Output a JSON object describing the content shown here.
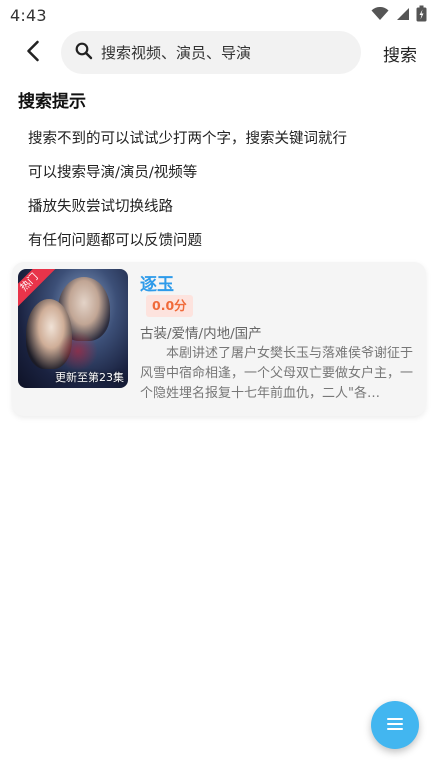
{
  "status_bar": {
    "time": "4:43"
  },
  "search": {
    "placeholder": "搜索视频、演员、导演",
    "value": "",
    "submit_label": "搜索"
  },
  "tips": {
    "title": "搜索提示",
    "items": [
      "搜索不到的可以试试少打两个字，搜索关键词就行",
      "可以搜索导演/演员/视频等",
      "播放失败尝试切换线路",
      "有任何问题都可以反馈问题"
    ]
  },
  "result": {
    "badge": "热门",
    "poster_caption": "更新至第23集",
    "title": "逐玉",
    "score": "0.0分",
    "tags": "古装/爱情/内地/国产",
    "description": "本剧讲述了屠户女樊长玉与落难侯爷谢征于风雪中宿命相逢，一个父母双亡要做女户主，一个隐姓埋名报复十七年前血仇，二人\"各…"
  },
  "colors": {
    "accent_blue": "#2e9bea",
    "fab_blue": "#42b6f0",
    "hot_red": "#e8344a",
    "score_orange": "#f06a3a"
  },
  "icons": [
    "wifi-icon",
    "signal-icon",
    "battery-icon",
    "back-arrow-icon",
    "search-icon",
    "menu-icon"
  ]
}
